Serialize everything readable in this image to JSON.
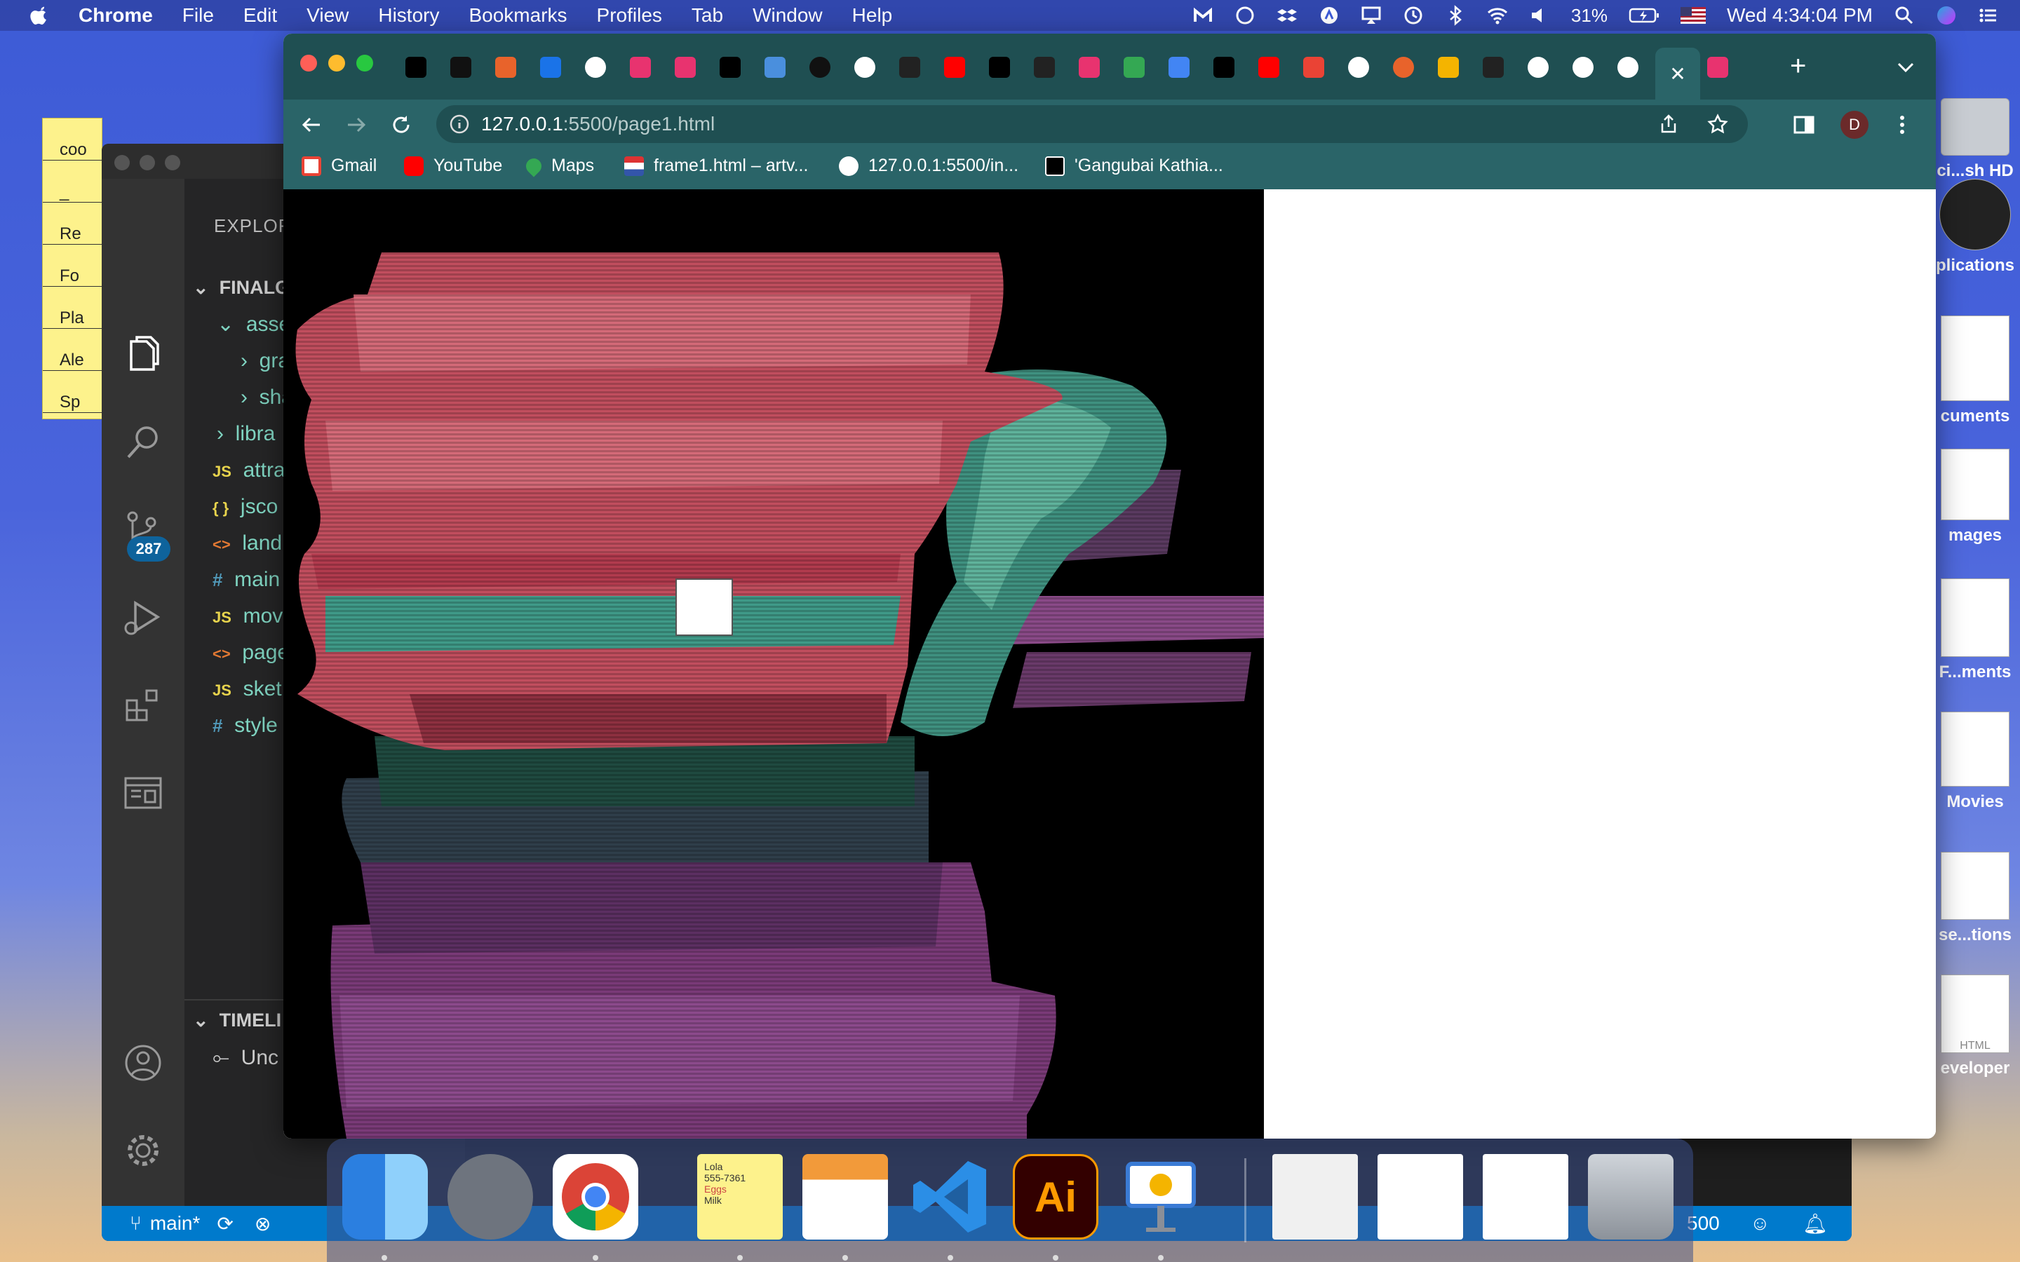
{
  "menubar": {
    "app_name": "Chrome",
    "items": [
      "File",
      "Edit",
      "View",
      "History",
      "Bookmarks",
      "Profiles",
      "Tab",
      "Window",
      "Help"
    ],
    "battery": "31%",
    "datetime": "Wed 4:34:04 PM"
  },
  "sticky_note": {
    "lines": [
      "coo",
      "_",
      "Re",
      "Fo",
      "Pla",
      "Ale",
      "Sp"
    ]
  },
  "vscode": {
    "explorer_header": "EXPLOR",
    "badge_count": "287",
    "tree": [
      {
        "chevron": "⌄",
        "label": "FINALG",
        "icon": ""
      },
      {
        "chevron": "⌄",
        "label": "asse",
        "icon": ""
      },
      {
        "chevron": "›",
        "label": "gra",
        "icon": ""
      },
      {
        "chevron": "›",
        "label": "sha",
        "icon": ""
      },
      {
        "chevron": "›",
        "label": "libra",
        "icon": ""
      },
      {
        "chevron": "",
        "label": "attra",
        "icon": "JS"
      },
      {
        "chevron": "",
        "label": "jsco",
        "icon": "{ }"
      },
      {
        "chevron": "",
        "label": "land",
        "icon": "<>"
      },
      {
        "chevron": "",
        "label": "main",
        "icon": "#"
      },
      {
        "chevron": "",
        "label": "mov",
        "icon": "JS"
      },
      {
        "chevron": "",
        "label": "page",
        "icon": "<>"
      },
      {
        "chevron": "",
        "label": "sket",
        "icon": "JS"
      },
      {
        "chevron": "",
        "label": "style",
        "icon": "#"
      }
    ],
    "timeline_header": "TIMELI",
    "timeline_item": "Unc",
    "status_branch": "main*",
    "status_right": "500"
  },
  "chrome": {
    "tabs": [
      {
        "icon": "grid-icon",
        "color": "#000000"
      },
      {
        "icon": "jm-icon",
        "color": "#111111"
      },
      {
        "icon": "s-icon",
        "color": "#e8632b"
      },
      {
        "icon": "g-blue-icon",
        "color": "#1a73e8"
      },
      {
        "icon": "google-icon",
        "color": "#ffffff"
      },
      {
        "icon": "asterisk-icon",
        "color": "#e8336f"
      },
      {
        "icon": "asterisk-icon",
        "color": "#e8336f"
      },
      {
        "icon": "dmt-icon",
        "color": "#000000"
      },
      {
        "icon": "puzzle-icon",
        "color": "#4a8fdd"
      },
      {
        "icon": "spiral-icon",
        "color": "#111111"
      },
      {
        "icon": "globe-icon",
        "color": "#ffffff"
      },
      {
        "icon": "nyt-icon",
        "color": "#222222"
      },
      {
        "icon": "youtube-icon",
        "color": "#ff0000"
      },
      {
        "icon": "medium-icon",
        "color": "#000000"
      },
      {
        "icon": "nyt-icon",
        "color": "#222222"
      },
      {
        "icon": "asterisk-icon",
        "color": "#e8336f"
      },
      {
        "icon": "drive-icon",
        "color": "#34a853"
      },
      {
        "icon": "docs-icon",
        "color": "#4285f4"
      },
      {
        "icon": "dmt-icon",
        "color": "#000000"
      },
      {
        "icon": "youtube-icon",
        "color": "#ff0000"
      },
      {
        "icon": "gmail-icon",
        "color": "#ea4335"
      },
      {
        "icon": "globe-icon",
        "color": "#ffffff"
      },
      {
        "icon": "dots-ring-icon",
        "color": "#e8632b"
      },
      {
        "icon": "slides-icon",
        "color": "#f4b400"
      },
      {
        "icon": "nyt-icon",
        "color": "#222222"
      },
      {
        "icon": "globe-icon",
        "color": "#ffffff"
      },
      {
        "icon": "globe-icon",
        "color": "#ffffff"
      },
      {
        "icon": "globe-icon",
        "color": "#ffffff"
      },
      {
        "icon": "close-icon",
        "color": "#ffffff",
        "active": true
      },
      {
        "icon": "asterisk-icon",
        "color": "#e8336f"
      }
    ],
    "url_host": "127.0.0.1",
    "url_rest": ":5500/page1.html",
    "profile_initial": "D",
    "bookmarks": [
      {
        "label": "Gmail",
        "icon": "gmail-icon",
        "color": "#ea4335"
      },
      {
        "label": "YouTube",
        "icon": "youtube-icon",
        "color": "#ff0000"
      },
      {
        "label": "Maps",
        "icon": "maps-icon",
        "color": "#34a853"
      },
      {
        "label": "frame1.html – artv...",
        "icon": "flag-icon",
        "color": "#7a5cd6"
      },
      {
        "label": "127.0.0.1:5500/in...",
        "icon": "globe-icon",
        "color": "#ffffff"
      },
      {
        "label": "'Gangubai Kathia...",
        "icon": "dmt-icon",
        "color": "#000000"
      }
    ]
  },
  "desktop": {
    "items": [
      "ci...sh HD",
      "plications",
      "cuments",
      "mages",
      "F...ments",
      "Movies",
      "se...tions",
      "eveloper"
    ],
    "html_label": "HTML"
  },
  "dock": {
    "apps": [
      {
        "name": "finder",
        "color": "#4aa7f0"
      },
      {
        "name": "launchpad",
        "color": "#8a8f98"
      },
      {
        "name": "chrome",
        "color": "#ffffff"
      },
      {
        "name": "stickies",
        "color": "#fdf28c"
      },
      {
        "name": "pages",
        "color": "#f29a3a"
      },
      {
        "name": "vscode",
        "color": "#2b8ee6"
      },
      {
        "name": "illustrator",
        "color": "#330000"
      },
      {
        "name": "keynote",
        "color": "#3a7bd5"
      },
      {
        "name": "doc-stack",
        "color": "#eeeeee"
      },
      {
        "name": "spreadsheet-doc",
        "color": "#ffffff"
      },
      {
        "name": "text-doc",
        "color": "#ffffff"
      },
      {
        "name": "trash",
        "color": "#aab0b8"
      }
    ],
    "stickies_lines": [
      "Lola",
      "555-7361",
      "Eggs",
      "Milk"
    ],
    "ai_label": "Ai"
  }
}
